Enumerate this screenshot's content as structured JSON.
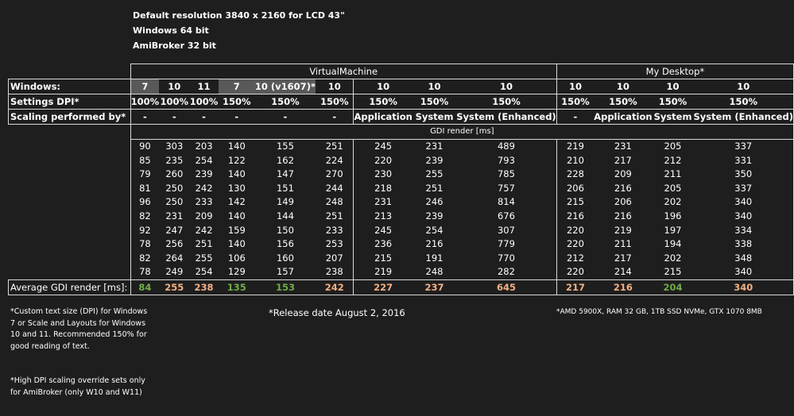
{
  "header": {
    "line1": "Default resolution 3840 x 2160 for LCD 43\"",
    "line2": "Windows 64 bit",
    "line3": "AmiBroker 32 bit"
  },
  "groups": {
    "vm": "VirtualMachine",
    "desktop": "My Desktop*"
  },
  "rows": {
    "windows_label": "Windows:",
    "dpi_label": "Settings DPI*",
    "scaling_label": "Scaling performed by*",
    "gdi_label": "GDI render [ms]",
    "avg_label": "Average GDI render [ms]:"
  },
  "columns": [
    {
      "windows": "7",
      "dpi": "100%",
      "scaling": "-"
    },
    {
      "windows": "10",
      "dpi": "100%",
      "scaling": "-"
    },
    {
      "windows": "11",
      "dpi": "100%",
      "scaling": "-"
    },
    {
      "windows": "7",
      "dpi": "150%",
      "scaling": "-"
    },
    {
      "windows": "10 (v1607)*",
      "dpi": "150%",
      "scaling": "-"
    },
    {
      "windows": "10",
      "dpi": "150%",
      "scaling": "-"
    },
    {
      "windows": "10",
      "dpi": "150%",
      "scaling": "Application"
    },
    {
      "windows": "10",
      "dpi": "150%",
      "scaling": "System"
    },
    {
      "windows": "10",
      "dpi": "150%",
      "scaling": "System (Enhanced)"
    },
    {
      "windows": "10",
      "dpi": "150%",
      "scaling": "-"
    },
    {
      "windows": "10",
      "dpi": "150%",
      "scaling": "Application"
    },
    {
      "windows": "10",
      "dpi": "150%",
      "scaling": "System"
    },
    {
      "windows": "10",
      "dpi": "150%",
      "scaling": "System (Enhanced)"
    }
  ],
  "measurements": [
    [
      "90",
      "303",
      "203",
      "140",
      "155",
      "251",
      "245",
      "231",
      "489",
      "219",
      "231",
      "205",
      "337"
    ],
    [
      "85",
      "235",
      "254",
      "122",
      "162",
      "224",
      "220",
      "239",
      "793",
      "210",
      "217",
      "212",
      "331"
    ],
    [
      "79",
      "260",
      "239",
      "140",
      "147",
      "270",
      "230",
      "255",
      "785",
      "228",
      "209",
      "211",
      "350"
    ],
    [
      "81",
      "250",
      "242",
      "130",
      "151",
      "244",
      "218",
      "251",
      "757",
      "206",
      "216",
      "205",
      "337"
    ],
    [
      "96",
      "250",
      "233",
      "142",
      "149",
      "248",
      "231",
      "246",
      "814",
      "215",
      "206",
      "202",
      "340"
    ],
    [
      "82",
      "231",
      "209",
      "140",
      "144",
      "251",
      "213",
      "239",
      "676",
      "216",
      "216",
      "196",
      "340"
    ],
    [
      "92",
      "247",
      "242",
      "159",
      "150",
      "233",
      "245",
      "254",
      "307",
      "220",
      "219",
      "197",
      "334"
    ],
    [
      "78",
      "256",
      "251",
      "140",
      "156",
      "253",
      "236",
      "216",
      "779",
      "220",
      "211",
      "194",
      "338"
    ],
    [
      "82",
      "264",
      "255",
      "106",
      "160",
      "207",
      "215",
      "191",
      "770",
      "212",
      "217",
      "202",
      "348"
    ],
    [
      "78",
      "249",
      "254",
      "129",
      "157",
      "238",
      "219",
      "248",
      "282",
      "220",
      "214",
      "215",
      "340"
    ]
  ],
  "averages": [
    "84",
    "255",
    "238",
    "135",
    "153",
    "242",
    "227",
    "237",
    "645",
    "217",
    "216",
    "204",
    "340"
  ],
  "average_colors": [
    "#70ad47",
    "#f4b183",
    "#f4b183",
    "#70ad47",
    "#70ad47",
    "#f4b183",
    "#f4b183",
    "#f4b183",
    "#f4b183",
    "#f4b183",
    "#f4b183",
    "#70ad47",
    "#f4b183"
  ],
  "notes": {
    "dpi_note": "*Custom text size (DPI) for Windows 7 or Scale and Layouts for Windows 10 and 11. Recommended 150% for good reading of text.",
    "override_note": "*High DPI scaling override sets only for AmiBroker (only W10 and W11)",
    "release_note": "*Release date August 2, 2016",
    "hardware_note": "*AMD 5900X, RAM 32 GB, 1TB SSD NVMe, GTX 1070 8MB"
  }
}
